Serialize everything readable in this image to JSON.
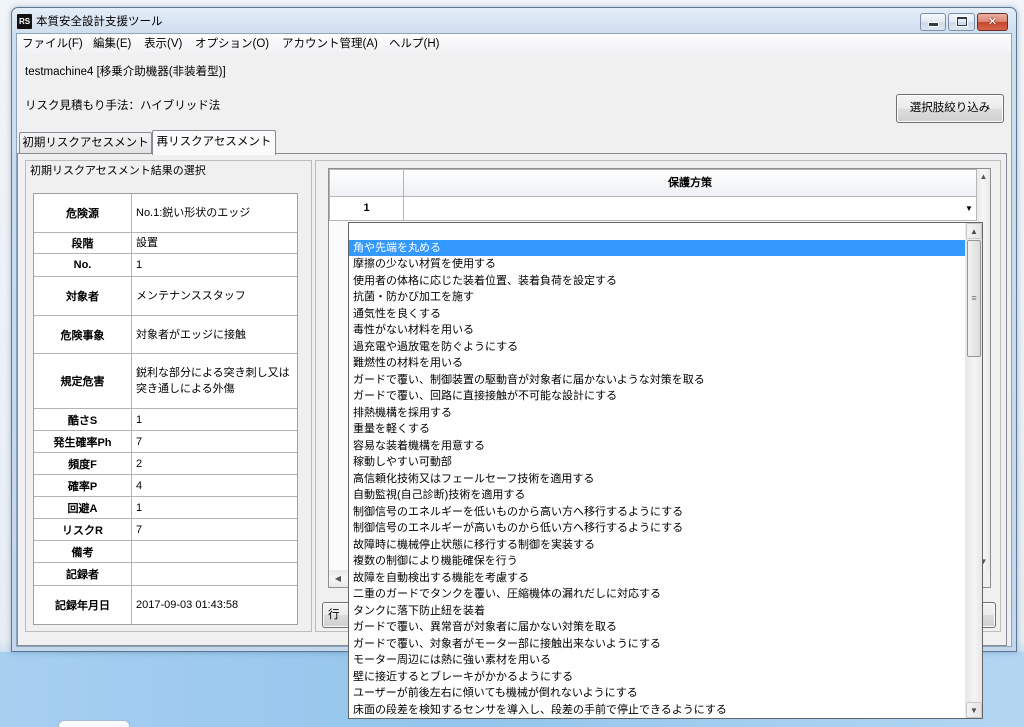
{
  "window": {
    "title": "本質安全設計支援ツール",
    "icon_text": "RS"
  },
  "menu": [
    {
      "label": "ファイル(F)"
    },
    {
      "label": "編集(E)"
    },
    {
      "label": "表示(V)"
    },
    {
      "label": "オプション(O)"
    },
    {
      "label": "アカウント管理(A)"
    },
    {
      "label": "ヘルプ(H)"
    }
  ],
  "header": {
    "machine": "testmachine4 [移乗介助機器(非装着型)]",
    "method": "リスク見積もり手法：ハイブリッド法",
    "filter_button": "選択肢絞り込み"
  },
  "tabs": [
    {
      "label": "初期リスクアセスメント",
      "selected": false
    },
    {
      "label": "再リスクアセスメント",
      "selected": true
    }
  ],
  "initial_assessment": {
    "title": "初期リスクアセスメント結果の選択",
    "rows": [
      {
        "label": "危険源",
        "value": "No.1:鋭い形状のエッジ"
      },
      {
        "label": "段階",
        "value": "設置"
      },
      {
        "label": "No.",
        "value": "1"
      },
      {
        "label": "対象者",
        "value": "メンテナンススタッフ"
      },
      {
        "label": "危険事象",
        "value": "対象者がエッジに接触"
      },
      {
        "label": "規定危害",
        "value": "鋭利な部分による突き刺し又は突き通しによる外傷"
      },
      {
        "label": "酷さS",
        "value": "1"
      },
      {
        "label": "発生確率Ph",
        "value": "7"
      },
      {
        "label": "頻度F",
        "value": "2"
      },
      {
        "label": "確率P",
        "value": "4"
      },
      {
        "label": "回避A",
        "value": "1"
      },
      {
        "label": "リスクR",
        "value": "7"
      },
      {
        "label": "備考",
        "value": ""
      },
      {
        "label": "記録者",
        "value": ""
      },
      {
        "label": "記録年月日",
        "value": "2017-09-03 01:43:58"
      }
    ]
  },
  "measures_grid": {
    "column_header": "保護方策",
    "rows": [
      {
        "index": "1",
        "value": ""
      }
    ],
    "row_button": "行"
  },
  "measure_dropdown": {
    "highlighted_index": 1,
    "options": [
      "",
      "角や先端を丸める",
      "摩擦の少ない材質を使用する",
      "使用者の体格に応じた装着位置、装着負荷を設定する",
      "抗菌・防かび加工を施す",
      "通気性を良くする",
      "毒性がない材料を用いる",
      "過充電や過放電を防ぐようにする",
      "難燃性の材料を用いる",
      "ガードで覆い、制御装置の駆動音が対象者に届かないような対策を取る",
      "ガードで覆い、回路に直接接触が不可能な設計にする",
      "排熱機構を採用する",
      "重量を軽くする",
      "容易な装着機構を用意する",
      "稼動しやすい可動部",
      "高信頼化技術又はフェールセーフ技術を適用する",
      "自動監視(自己診断)技術を適用する",
      "制御信号のエネルギーを低いものから高い方へ移行するようにする",
      "制御信号のエネルギーが高いものから低い方へ移行するようにする",
      "故障時に機械停止状態に移行する制御を実装する",
      "複数の制御により機能確保を行う",
      "故障を自動検出する機能を考慮する",
      "二重のガードでタンクを覆い、圧縮機体の漏れだしに対応する",
      "タンクに落下防止紐を装着",
      "ガードで覆い、異常音が対象者に届かない対策を取る",
      "ガードで覆い、対象者がモーター部に接触出来ないようにする",
      "モーター周辺には熱に強い素材を用いる",
      "壁に接近するとブレーキがかかるようにする",
      "ユーザーが前後左右に傾いても機械が倒れないようにする",
      "床面の段差を検知するセンサを導入し、段差の手前で停止できるようにする"
    ]
  },
  "icons": {
    "minimize": "minimize-icon",
    "maximize": "maximize-icon",
    "close": "close-icon",
    "combo_arrow": "chevron-down-icon",
    "scroll_up": "scroll-up-arrow-icon",
    "scroll_down": "scroll-down-arrow-icon",
    "scroll_left": "scroll-left-arrow-icon"
  },
  "colors": {
    "highlight": "#3399ff",
    "close_button": "#c7472f"
  }
}
